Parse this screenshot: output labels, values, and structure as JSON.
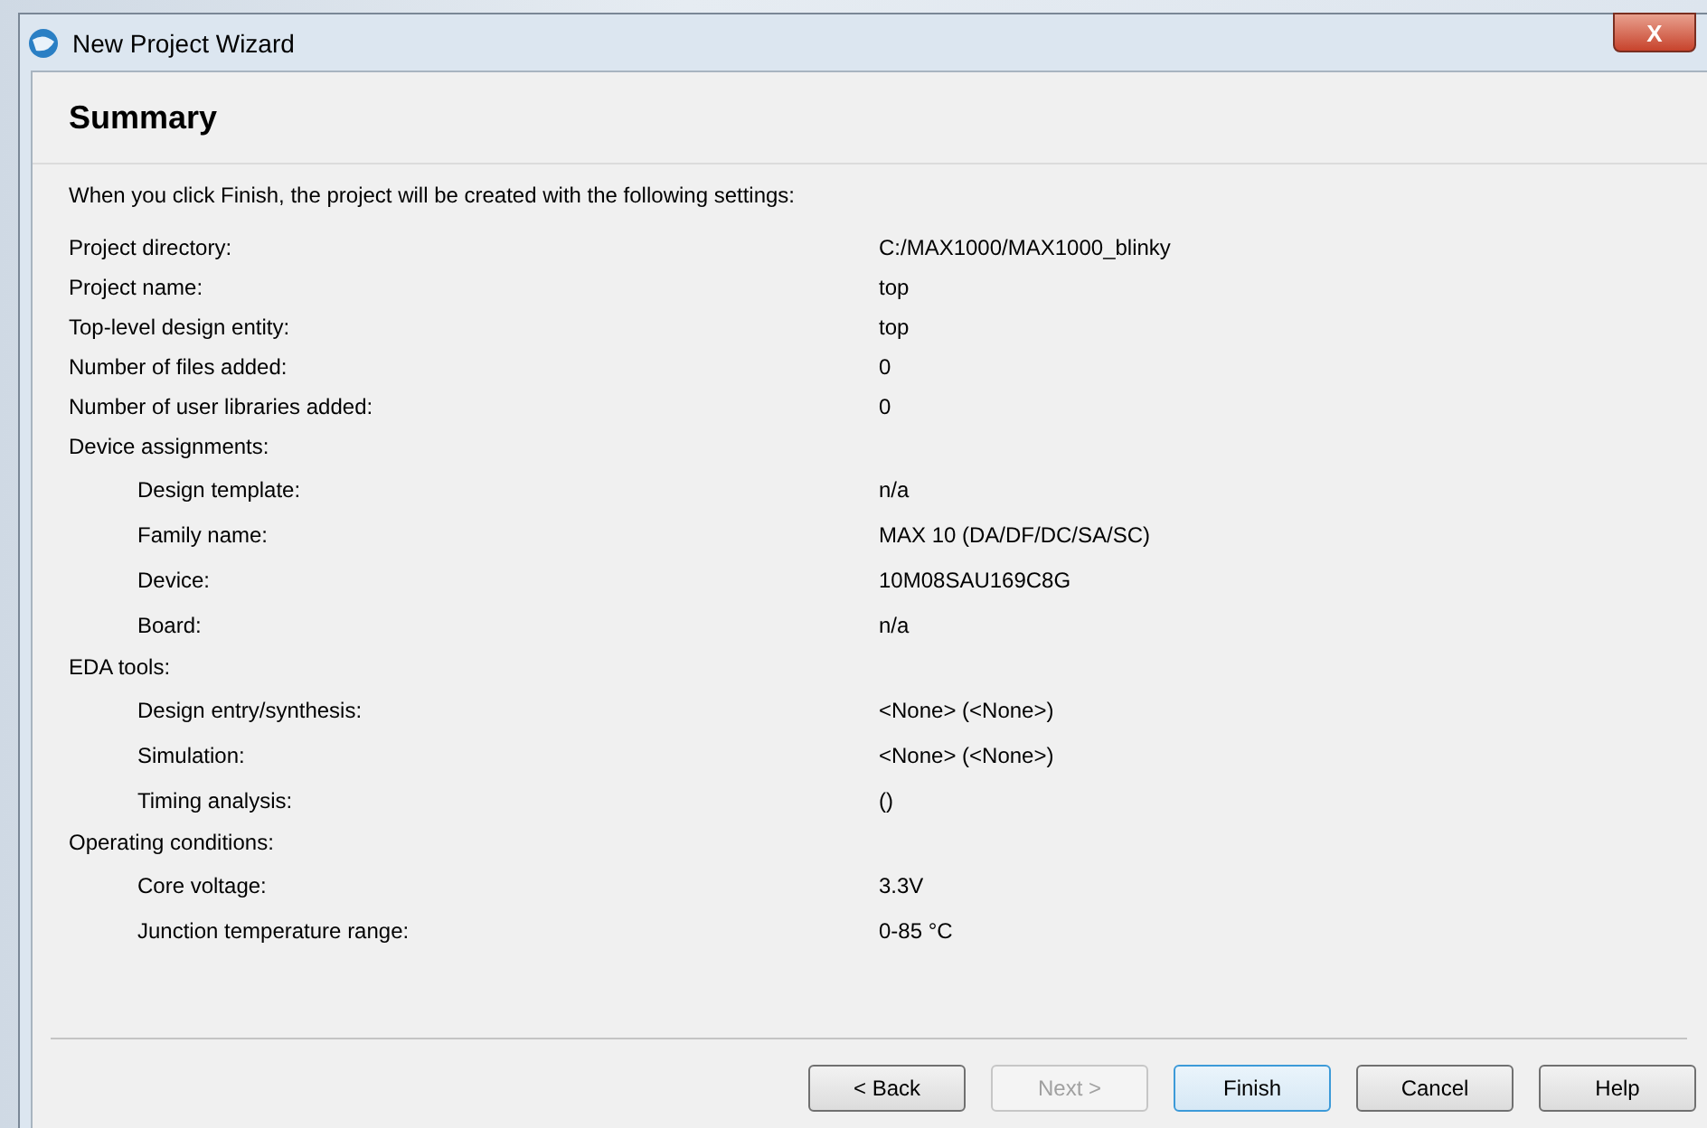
{
  "window": {
    "title": "New Project Wizard",
    "close": "X"
  },
  "heading": "Summary",
  "intro": "When you click Finish, the project will be created with the following settings:",
  "settings": [
    {
      "label": "Project directory:",
      "value": "C:/MAX1000/MAX1000_blinky"
    },
    {
      "label": "Project name:",
      "value": "top"
    },
    {
      "label": "Top-level design entity:",
      "value": "top"
    },
    {
      "label": "Number of files added:",
      "value": "0"
    },
    {
      "label": "Number of user libraries added:",
      "value": "0"
    },
    {
      "label": "Device assignments:",
      "children": [
        {
          "label": "Design template:",
          "value": "n/a"
        },
        {
          "label": "Family name:",
          "value": "MAX 10 (DA/DF/DC/SA/SC)"
        },
        {
          "label": "Device:",
          "value": "10M08SAU169C8G"
        },
        {
          "label": "Board:",
          "value": "n/a"
        }
      ]
    },
    {
      "label": "EDA tools:",
      "children": [
        {
          "label": "Design entry/synthesis:",
          "value": "<None> (<None>)"
        },
        {
          "label": "Simulation:",
          "value": "<None> (<None>)"
        },
        {
          "label": "Timing analysis:",
          "value": " ()"
        }
      ]
    },
    {
      "label": "Operating conditions:",
      "children": [
        {
          "label": "Core voltage:",
          "value": "3.3V"
        },
        {
          "label": "Junction temperature range:",
          "value": "0-85 °C"
        }
      ]
    }
  ],
  "buttons": [
    {
      "label": "< Back",
      "disabled": false,
      "default": false
    },
    {
      "label": "Next >",
      "disabled": true,
      "default": false
    },
    {
      "label": "Finish",
      "disabled": false,
      "default": true
    },
    {
      "label": "Cancel",
      "disabled": false,
      "default": false
    },
    {
      "label": "Help",
      "disabled": false,
      "default": false
    }
  ]
}
